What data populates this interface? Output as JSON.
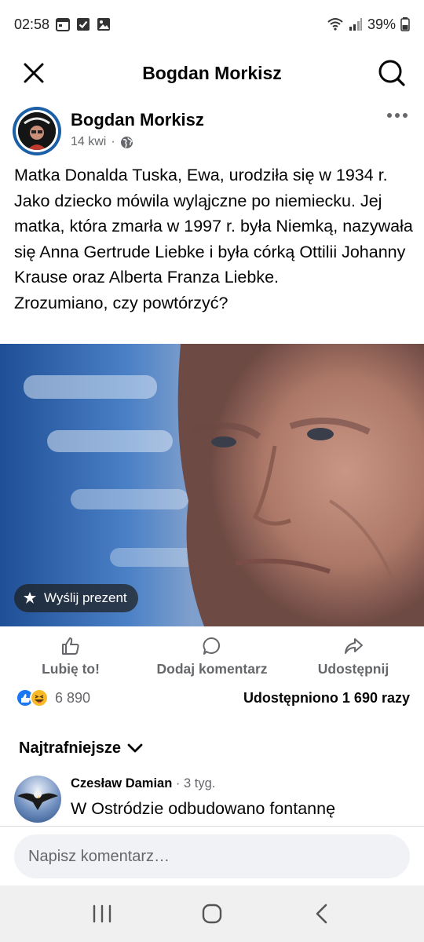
{
  "status_bar": {
    "time": "02:58",
    "battery": "39%",
    "notification_icons": [
      "calendar-icon",
      "checkbox-icon",
      "image-icon"
    ],
    "system_icons": [
      "wifi-icon",
      "signal-icon",
      "battery-icon"
    ]
  },
  "header": {
    "title": "Bogdan Morkisz",
    "close_icon": "close-icon",
    "search_icon": "search-icon"
  },
  "post": {
    "author": "Bogdan Morkisz",
    "time": "14 kwi",
    "separator": "·",
    "audience_icon": "globe-icon",
    "text": "Matka Donalda Tuska, Ewa, urodziła się w 1934 r. Jako dziecko mówila wyląjczne po niemiecku. Jej matka, która zmarła w 1997 r. była Niemką, nazywała się Anna Gertrude Liebke i była córką Ottilii Johanny Krause oraz Alberta Franza Liebke.\nZrozumiano, czy powtórzyć?",
    "gift_label": "Wyślij prezent"
  },
  "actions": {
    "like": "Lubię to!",
    "comment": "Dodaj komentarz",
    "share": "Udostępnij"
  },
  "reactions": {
    "count": "6 890",
    "shares": "Udostępniono 1 690 razy",
    "colors": {
      "like": "#1877f2",
      "haha": "#f7b928"
    }
  },
  "comments": {
    "sort_label": "Najtrafniejsze",
    "items": [
      {
        "author": "Czesław Damian",
        "time": "· 3 tyg.",
        "text": "W Ostródzie odbudowano fontannę"
      }
    ],
    "input_placeholder": "Napisz komentarz…"
  },
  "nav": {
    "recents_icon": "recents-icon",
    "home_icon": "home-icon",
    "back_icon": "back-icon"
  }
}
